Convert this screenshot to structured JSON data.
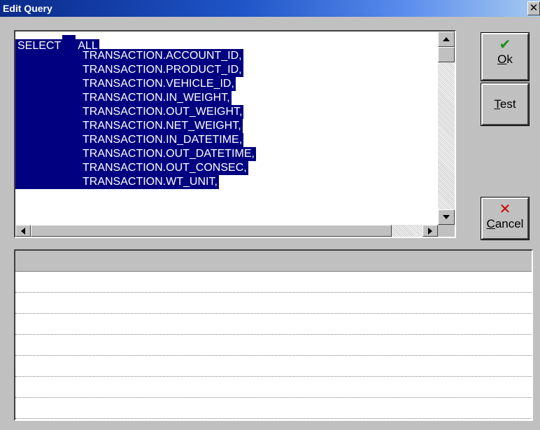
{
  "window": {
    "title": "Edit Query",
    "close_glyph": "✕"
  },
  "query": {
    "keyword": "SELECT",
    "modifier": "ALL",
    "columns": [
      "TRANSACTION.ACCOUNT_ID,",
      "TRANSACTION.PRODUCT_ID,",
      "TRANSACTION.VEHICLE_ID,",
      "TRANSACTION.IN_WEIGHT,",
      "TRANSACTION.OUT_WEIGHT,",
      "TRANSACTION.NET_WEIGHT,",
      "TRANSACTION.IN_DATETIME,",
      "TRANSACTION.OUT_DATETIME,",
      "TRANSACTION.OUT_CONSEC,",
      "TRANSACTION.WT_UNIT,"
    ]
  },
  "buttons": {
    "ok": {
      "mnemonic": "O",
      "rest": "k",
      "icon": "checkmark-icon",
      "icon_color": "#1a8f1a"
    },
    "test": {
      "mnemonic": "T",
      "rest": "est"
    },
    "cancel": {
      "mnemonic": "C",
      "rest": "ancel",
      "icon": "x-icon",
      "icon_color": "#cc0000"
    }
  },
  "colors": {
    "selection": "#000080",
    "titlebar": "#0a2a8a",
    "face": "#c0c0c0"
  }
}
